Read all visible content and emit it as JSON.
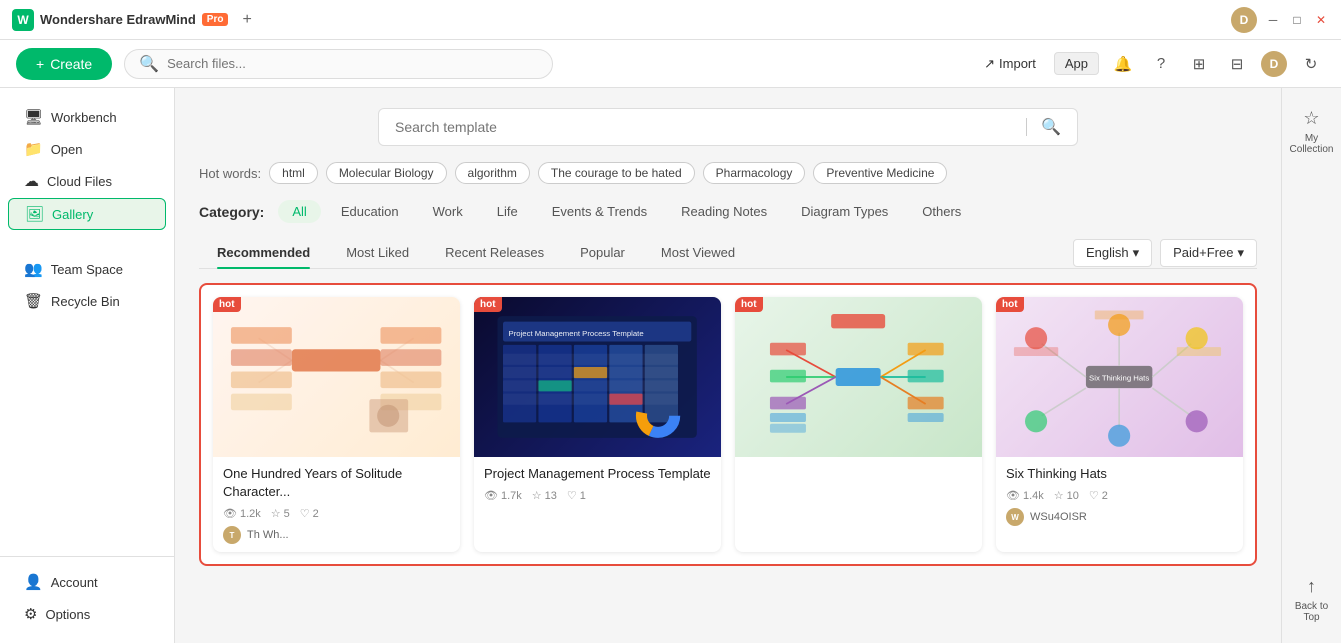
{
  "app": {
    "title": "Wondershare EdrawMind",
    "plan": "Pro",
    "tab_add": "+",
    "user_initial": "D"
  },
  "toolbar": {
    "create_label": "Create",
    "search_placeholder": "Search files...",
    "import_label": "Import",
    "app_label": "App"
  },
  "sidebar": {
    "workbench_label": "Workbench",
    "open_label": "Open",
    "cloud_label": "Cloud Files",
    "gallery_label": "Gallery",
    "team_label": "Team Space",
    "recycle_label": "Recycle Bin",
    "account_label": "Account",
    "options_label": "Options"
  },
  "template": {
    "search_placeholder": "Search template",
    "hot_words_label": "Hot words:",
    "hot_tags": [
      "html",
      "Molecular Biology",
      "algorithm",
      "The courage to be hated",
      "Pharmacology",
      "Preventive Medicine"
    ],
    "category_label": "Category:",
    "categories": [
      "All",
      "Education",
      "Work",
      "Life",
      "Events & Trends",
      "Reading Notes",
      "Diagram Types",
      "Others"
    ],
    "active_category": "All",
    "sub_tabs": [
      "Recommended",
      "Most Liked",
      "Recent Releases",
      "Popular",
      "Most Viewed"
    ],
    "active_sub_tab": "Recommended",
    "language_filter": "English",
    "price_filter": "Paid+Free"
  },
  "gallery": {
    "cards": [
      {
        "id": 1,
        "title": "One Hundred Years of Solitude Character...",
        "hot": true,
        "views": "1.2k",
        "stars": "5",
        "likes": "2",
        "author": "Th Wh...",
        "thumb_type": "warm"
      },
      {
        "id": 2,
        "title": "Project Management Process Template",
        "hot": true,
        "views": "1.7k",
        "stars": "13",
        "likes": "1",
        "author": "",
        "thumb_type": "dark"
      },
      {
        "id": 3,
        "title": "",
        "hot": true,
        "views": "",
        "stars": "",
        "likes": "",
        "author": "",
        "thumb_type": "green"
      },
      {
        "id": 4,
        "title": "Six Thinking Hats",
        "hot": true,
        "views": "1.4k",
        "stars": "10",
        "likes": "2",
        "author": "WSu4OISR",
        "thumb_type": "purple"
      }
    ]
  },
  "right_panel": {
    "collection_label": "My Collection",
    "back_to_top_label": "Back to Top"
  },
  "icons": {
    "search": "🔍",
    "create_plus": "+",
    "import": "↗",
    "bell": "🔔",
    "help": "?",
    "grid": "⊞",
    "layout": "⊟",
    "refresh": "↻",
    "workbench": "🖥",
    "open": "📁",
    "cloud": "☁",
    "gallery": "🖼",
    "team": "👥",
    "recycle": "🗑",
    "account": "👤",
    "options": "⚙",
    "star": "☆",
    "eye": "👁",
    "heart": "♡",
    "chevron_down": "▾",
    "bookmark": "☆",
    "arrow_up": "↑"
  }
}
